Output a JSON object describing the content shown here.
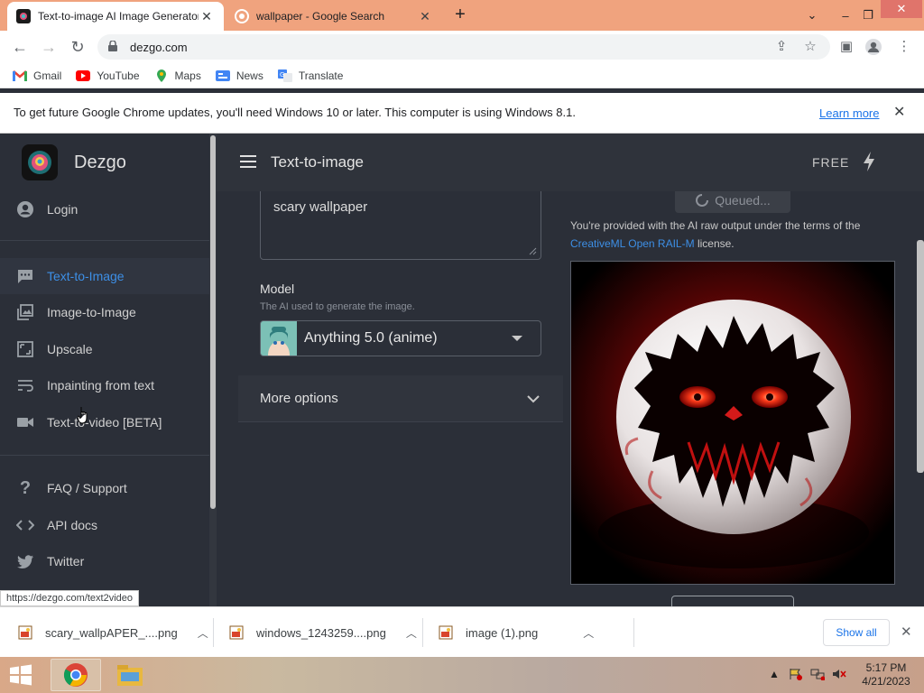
{
  "browser": {
    "tabs": [
      {
        "title": "Text-to-image AI Image Generator",
        "active": true
      },
      {
        "title": "wallpaper - Google Search",
        "active": false
      }
    ],
    "new_tab": "+",
    "url": "dezgo.com",
    "bookmarks": [
      "Gmail",
      "YouTube",
      "Maps",
      "News",
      "Translate"
    ],
    "infobar": {
      "message": "To get future Google Chrome updates, you'll need Windows 10 or later. This computer is using Windows 8.1.",
      "link": "Learn more"
    },
    "status_url": "https://dezgo.com/text2video"
  },
  "app": {
    "brand": "Dezgo",
    "header_title": "Text-to-image",
    "plan": "FREE",
    "sidebar": {
      "login": "Login",
      "tools": [
        "Text-to-Image",
        "Image-to-Image",
        "Upscale",
        "Inpainting from text",
        "Text-to-video [BETA]"
      ],
      "links": [
        "FAQ / Support",
        "API docs",
        "Twitter"
      ]
    },
    "prompt_value": "scary wallpaper",
    "model": {
      "label": "Model",
      "help": "The AI used to generate the image.",
      "selected": "Anything 5.0 (anime)"
    },
    "more_options": "More options",
    "queued": "Queued...",
    "license_before": "You're provided with the AI raw output under the terms of the",
    "license_link": "CreativeML Open RAIL-M",
    "license_after": "license."
  },
  "downloads": {
    "items": [
      "scary_wallpAPER_....png",
      "windows_1243259....png",
      "image (1).png"
    ],
    "show_all": "Show all"
  },
  "taskbar": {
    "time": "5:17 PM",
    "date": "4/21/2023"
  },
  "colors": {
    "accent": "#3d8fe6",
    "sidebar_bg": "#2b2f38",
    "tab_strip": "#f0a37e"
  }
}
